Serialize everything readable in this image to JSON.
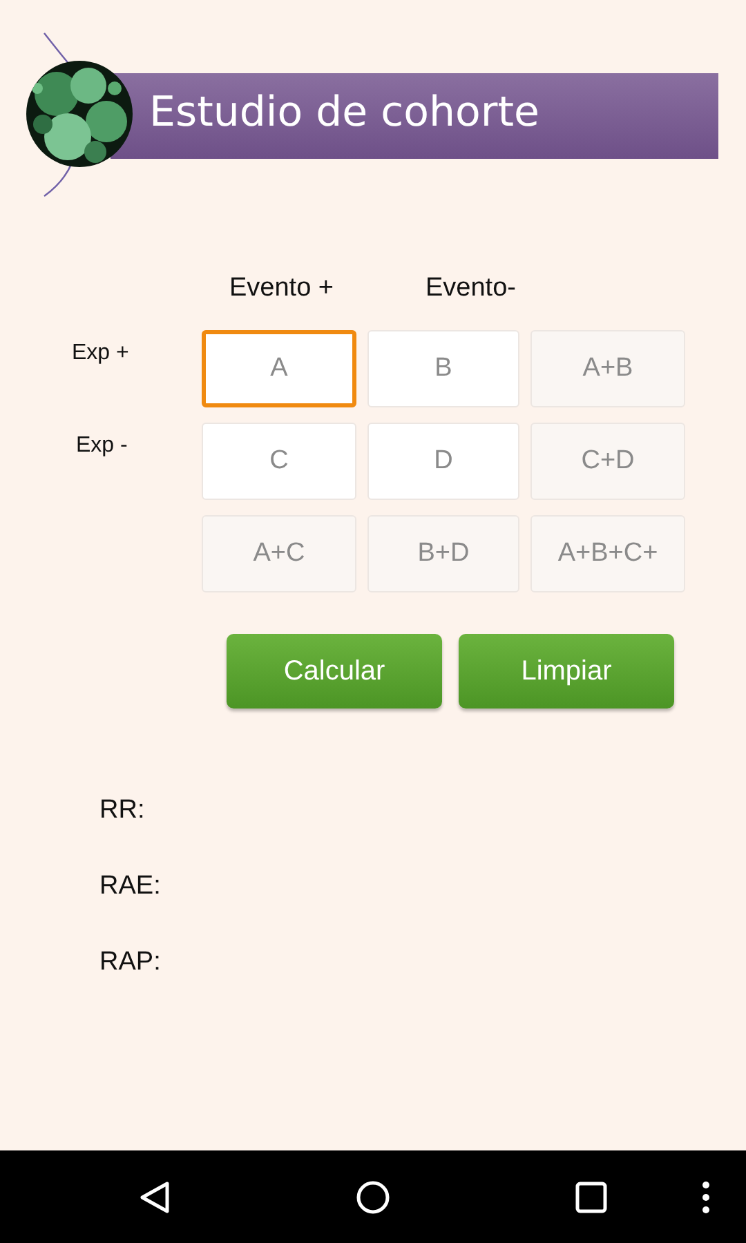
{
  "header": {
    "title": "Estudio de cohorte"
  },
  "table": {
    "column_headers": [
      "Evento +",
      "Evento-"
    ],
    "row_headers": [
      "Exp +",
      "Exp -"
    ],
    "rows": [
      [
        {
          "placeholder": "A",
          "kind": "entry",
          "focused": true
        },
        {
          "placeholder": "B",
          "kind": "entry",
          "focused": false
        },
        {
          "placeholder": "A+B",
          "kind": "total",
          "focused": false
        }
      ],
      [
        {
          "placeholder": "C",
          "kind": "entry",
          "focused": false
        },
        {
          "placeholder": "D",
          "kind": "entry",
          "focused": false
        },
        {
          "placeholder": "C+D",
          "kind": "total",
          "focused": false
        }
      ],
      [
        {
          "placeholder": "A+C",
          "kind": "total",
          "focused": false
        },
        {
          "placeholder": "B+D",
          "kind": "total",
          "focused": false
        },
        {
          "placeholder": "A+B+C+",
          "kind": "total",
          "focused": false
        }
      ]
    ]
  },
  "buttons": [
    {
      "label": "Calcular"
    },
    {
      "label": "Limpiar"
    }
  ],
  "results": [
    {
      "label": "RR:"
    },
    {
      "label": "RAE:"
    },
    {
      "label": "RAP:"
    }
  ]
}
